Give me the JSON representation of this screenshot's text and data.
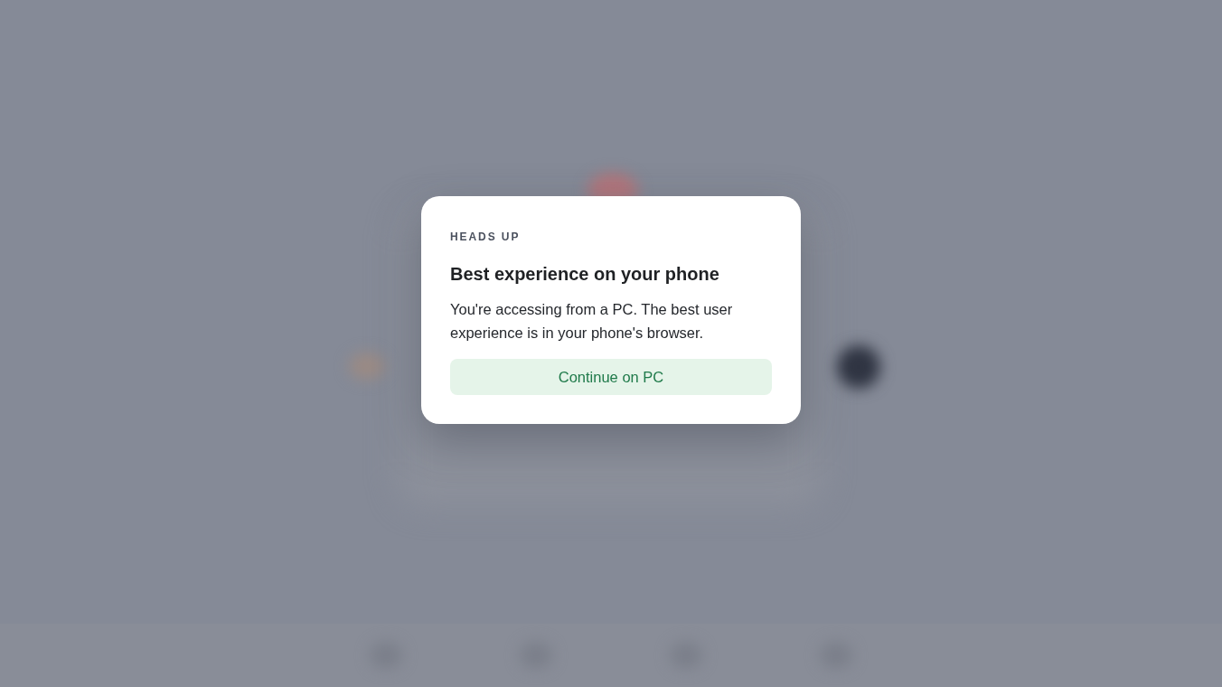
{
  "dialog": {
    "eyebrow": "HEADS UP",
    "title": "Best experience on your phone",
    "message": "You're accessing from a PC. The best user experience is in your phone's browser.",
    "button": "Continue on PC"
  }
}
